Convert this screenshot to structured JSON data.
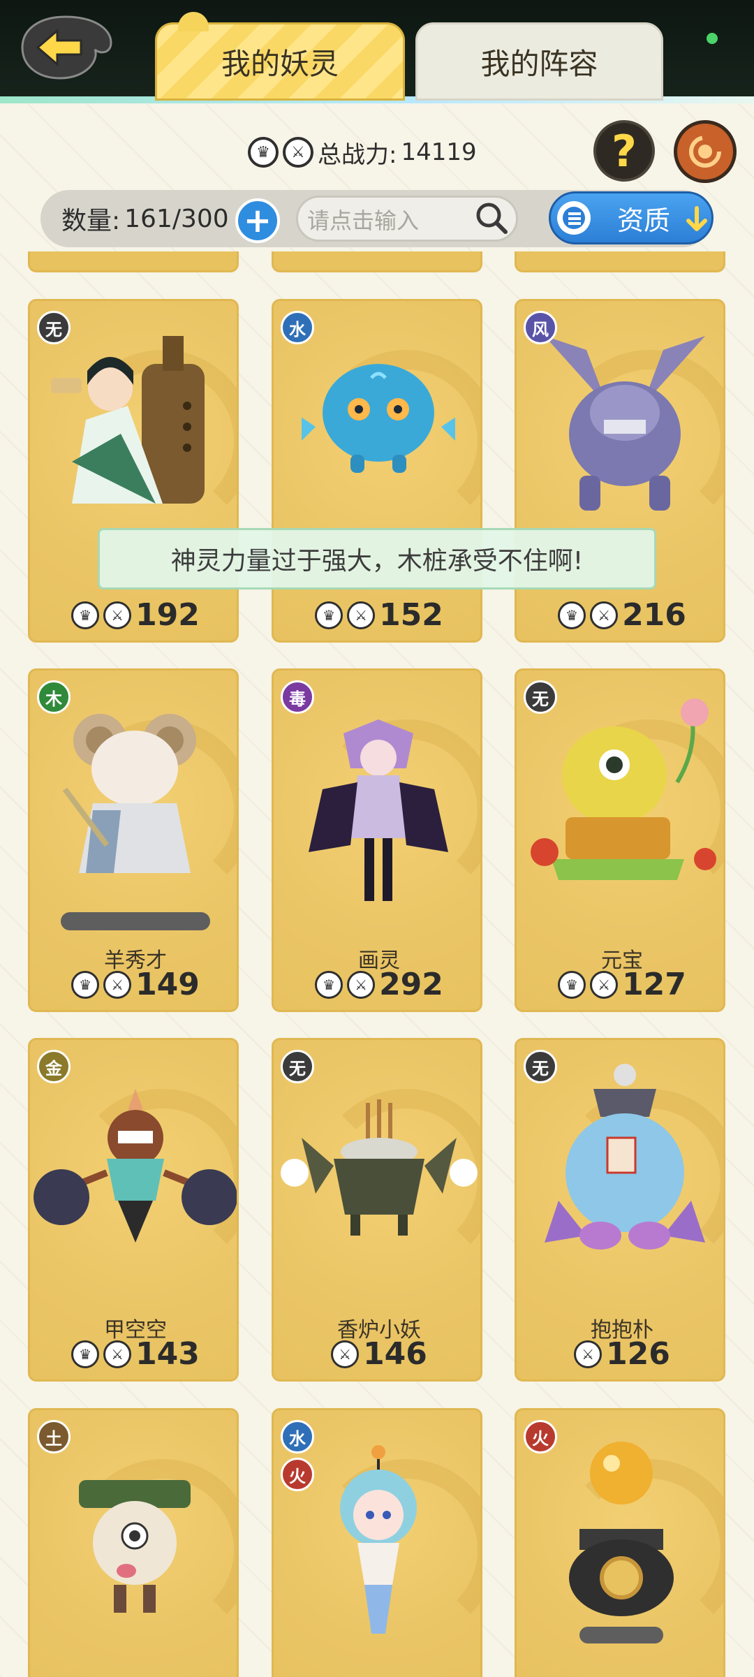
{
  "header": {
    "tabs": [
      {
        "label": "我的妖灵",
        "active": true
      },
      {
        "label": "我的阵容",
        "active": false
      }
    ]
  },
  "power_summary": {
    "label": "总战力:",
    "value": "14119"
  },
  "filter": {
    "count_label": "数量:",
    "count_value": "161/300",
    "search_placeholder": "请点击输入",
    "quality_label": "资质"
  },
  "toast": {
    "message": "神灵力量过于强大，木桩承受不住啊!"
  },
  "cards": [
    {
      "element": "无",
      "name": "",
      "power": "192"
    },
    {
      "element": "水",
      "name": "",
      "power": "152"
    },
    {
      "element": "风",
      "name": "",
      "power": "216"
    },
    {
      "element": "木",
      "name": "羊秀才",
      "power": "149"
    },
    {
      "element": "毒",
      "name": "画灵",
      "power": "292"
    },
    {
      "element": "无",
      "name": "元宝",
      "power": "127"
    },
    {
      "element": "金",
      "name": "甲空空",
      "power": "143"
    },
    {
      "element": "无",
      "name": "香炉小妖",
      "power": "146"
    },
    {
      "element": "无",
      "name": "抱抱朴",
      "power": "126"
    },
    {
      "element": "土",
      "name": "",
      "power": ""
    },
    {
      "element": "水",
      "element2": "火",
      "name": "",
      "power": ""
    },
    {
      "element": "火",
      "name": "",
      "power": ""
    }
  ],
  "colors": {
    "card_bg": "#eac566",
    "tab_active": "#ffe58a",
    "accent_blue": "#2f8de0"
  }
}
